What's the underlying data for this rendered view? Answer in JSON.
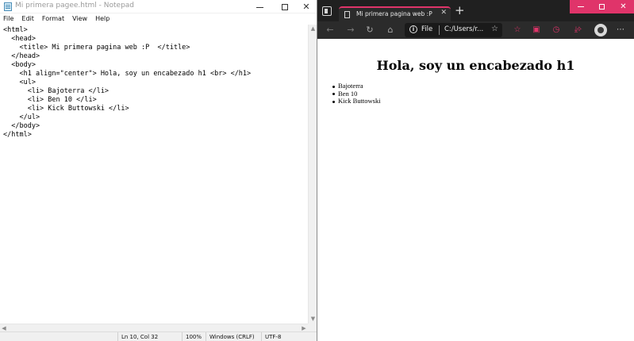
{
  "notepad": {
    "title": "Mi primera pagee.html - Notepad",
    "menu": [
      "File",
      "Edit",
      "Format",
      "View",
      "Help"
    ],
    "lines": [
      "<html>",
      "  <head>",
      "    <title> Mi primera pagina web :P  </title>",
      "  </head>",
      "  <body>",
      "    <h1 align=\"center\"> Hola, soy un encabezado h1 <br> </h1>",
      "    <ul>",
      "      <li> Bajoterra </li>",
      "      <li> Ben 10 </li>",
      "      <li> Kick Buttowski </li>",
      "    </ul>",
      "  </body>",
      "</html>"
    ],
    "status": {
      "position": "Ln 10, Col 32",
      "zoom": "100%",
      "line_ending": "Windows (CRLF)",
      "encoding": "UTF-8"
    },
    "icons": [
      "notepad-app-icon",
      "minimize-icon",
      "maximize-icon",
      "close-icon"
    ]
  },
  "browser": {
    "tab_title": "Mi primera pagina web :P",
    "address": {
      "scheme": "File",
      "url": "C:/Users/r..."
    },
    "accent_color": "#e0346a",
    "page": {
      "heading": "Hola, soy un encabezado h1",
      "items": [
        "Bajoterra",
        "Ben 10",
        "Kick Buttowski"
      ]
    },
    "icons": [
      "tab-actions-icon",
      "document-icon",
      "close-tab-icon",
      "new-tab-icon",
      "back-icon",
      "forward-icon",
      "reload-icon",
      "home-icon",
      "info-icon",
      "add-favorite-icon",
      "favorites-icon",
      "history-icon",
      "downloads-icon",
      "extensions-icon",
      "profile-icon",
      "more-icon"
    ]
  }
}
